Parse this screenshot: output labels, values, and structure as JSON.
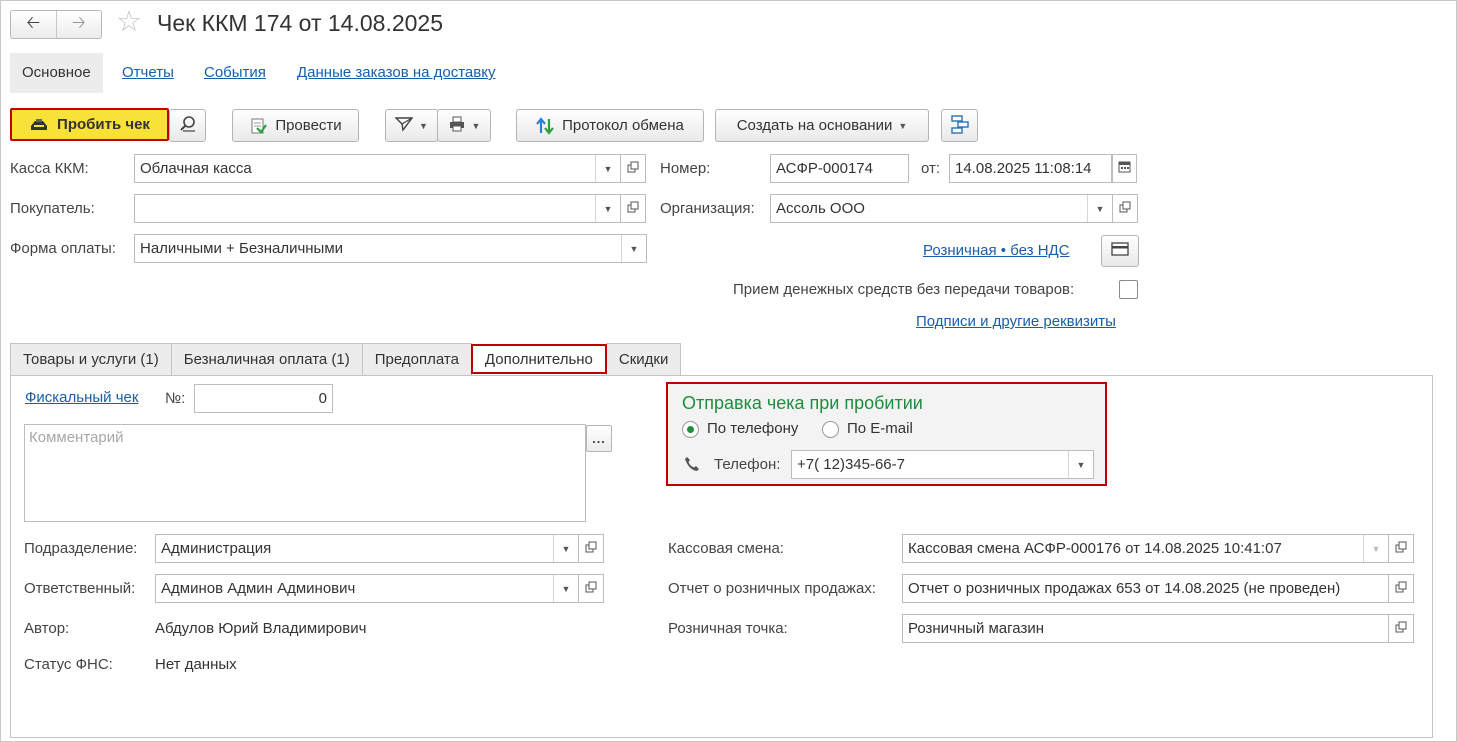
{
  "window": {
    "title": "Чек ККМ 174 от 14.08.2025"
  },
  "nav": {
    "back_icon": "arrow-left-icon",
    "forward_icon": "arrow-right-icon",
    "favorite_icon": "star-icon"
  },
  "top_tabs": [
    {
      "label": "Основное",
      "active": true
    },
    {
      "label": "Отчеты"
    },
    {
      "label": "События"
    },
    {
      "label": "Данные заказов на доставку"
    }
  ],
  "toolbar": {
    "print_receipt": "Пробить чек",
    "post": "Провести",
    "exchange_log": "Протокол обмена",
    "create_based_on": "Создать на основании"
  },
  "header_fields": {
    "cash_register": {
      "label": "Касса ККМ:",
      "value": "Облачная касса"
    },
    "number": {
      "label": "Номер:",
      "value": "АСФР-000174"
    },
    "date": {
      "label": "от:",
      "value": "14.08.2025 11:08:14"
    },
    "buyer": {
      "label": "Покупатель:",
      "value": ""
    },
    "organization": {
      "label": "Организация:",
      "value": "Ассоль ООО"
    },
    "payment_form": {
      "label": "Форма оплаты:",
      "value": "Наличными + Безналичными"
    },
    "price_type_link": "Розничная • без НДС",
    "no_goods_transfer": {
      "label": "Прием денежных средств без передачи товаров:",
      "checked": false
    },
    "signatures_link": "Подписи и другие реквизиты"
  },
  "tabs": [
    {
      "label": "Товары и услуги (1)"
    },
    {
      "label": "Безналичная оплата (1)"
    },
    {
      "label": "Предоплата"
    },
    {
      "label": "Дополнительно",
      "selected": true
    },
    {
      "label": "Скидки"
    }
  ],
  "additional": {
    "fiscal_link": "Фискальный чек",
    "fiscal_no_label": "№:",
    "fiscal_no_value": "0",
    "comment_placeholder": "Комментарий",
    "more_button": "...",
    "send_group": {
      "title": "Отправка чека при пробитии",
      "options": [
        {
          "label": "По телефону",
          "selected": true
        },
        {
          "label": "По E-mail",
          "selected": false
        }
      ],
      "phone_label": "Телефон:",
      "phone_value": "+7( 12)345-66-7"
    },
    "department": {
      "label": "Подразделение:",
      "value": "Администрация"
    },
    "responsible": {
      "label": "Ответственный:",
      "value": "Админов Админ Админович"
    },
    "author": {
      "label": "Автор:",
      "value": "Абдулов Юрий Владимирович"
    },
    "fns_status": {
      "label": "Статус ФНС:",
      "value": "Нет данных"
    },
    "cash_shift": {
      "label": "Кассовая смена:",
      "value": "Кассовая смена АСФР-000176 от 14.08.2025 10:41:07"
    },
    "retail_report": {
      "label": "Отчет о розничных продажах:",
      "value": "Отчет о розничных продажах 653 от 14.08.2025 (не проведен)"
    },
    "retail_point": {
      "label": "Розничная точка:",
      "value": "Розничный магазин"
    }
  },
  "colors": {
    "accent_yellow": "#f8e23a",
    "highlight_red": "#c00000",
    "link_blue": "#1a5ea8",
    "group_green": "#1e8e3e"
  }
}
